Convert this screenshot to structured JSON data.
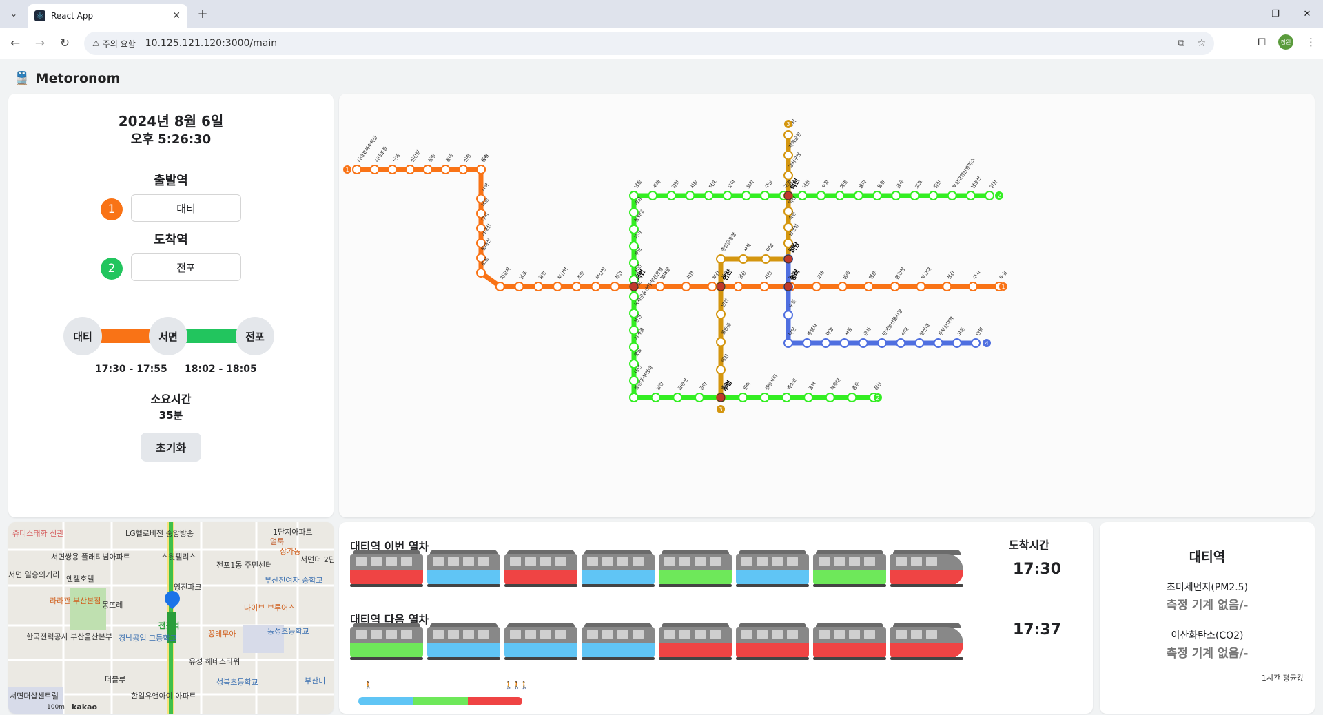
{
  "browser": {
    "tab_title": "React App",
    "security_label": "주의 요함",
    "url": "10.125.121.120:3000/main",
    "profile_initials": "정원"
  },
  "app": {
    "title": "Metoronom",
    "date": "2024년 8월 6일",
    "time": "오후 5:26:30",
    "departure_label": "출발역",
    "departure_line": "1",
    "departure_station": "대티",
    "arrival_label": "도착역",
    "arrival_line": "2",
    "arrival_station": "전포",
    "route": {
      "start": "대티",
      "transfer": "서면",
      "end": "전포",
      "segment1_time": "17:30 - 17:55",
      "segment2_time": "18:02 - 18:05",
      "segment1_color": "#f97316",
      "segment2_color": "#22c55e"
    },
    "duration_label": "소요시간",
    "duration": "35분",
    "reset_label": "초기화"
  },
  "colors": {
    "line1": "#f97316",
    "line2": "#33ee22",
    "line3": "#d4960f",
    "line4": "#4f6fe0"
  },
  "subway_map": {
    "line1_stations": [
      "다대포해수욕장",
      "다대포항",
      "낫개",
      "신장림",
      "장림",
      "동매",
      "신평",
      "하단",
      "당리",
      "사하",
      "괴정",
      "대티",
      "서대신",
      "동대신",
      "토성",
      "자갈치",
      "남포",
      "중앙",
      "부산역",
      "초량",
      "부산진",
      "좌천",
      "범일",
      "범내골",
      "서면",
      "부전",
      "양정",
      "시청",
      "연산",
      "교대",
      "동래",
      "명륜",
      "온천장",
      "부산대",
      "장전",
      "구서",
      "두실",
      "남산",
      "범어사",
      "노포"
    ],
    "line2_stations": [
      "양산",
      "남양산",
      "부산대양산캠퍼스",
      "증산",
      "호포",
      "금곡",
      "동원",
      "율리",
      "화명",
      "수정",
      "덕천",
      "구명",
      "구남",
      "모라",
      "모덕",
      "덕포",
      "사상",
      "감전",
      "주례",
      "냉정",
      "개금",
      "동의대",
      "가야",
      "부암",
      "서면",
      "전포",
      "국제금융센터·부산은행",
      "문현",
      "지게골",
      "못골",
      "대연",
      "경성대·부경대",
      "남천",
      "금련산",
      "광안",
      "수영",
      "민락",
      "센텀시티",
      "벡스코",
      "동백",
      "해운대",
      "중동",
      "장산"
    ],
    "line3_stations": [
      "대저",
      "체육공원",
      "강서구청",
      "구포",
      "덕천",
      "숙등",
      "남산정",
      "만덕",
      "미남",
      "사직",
      "종합운동장",
      "거제",
      "연산",
      "물만골",
      "배산",
      "망미",
      "수영"
    ],
    "line4_stations": [
      "미남",
      "동래",
      "수안",
      "낙민",
      "충렬사",
      "명장",
      "서동",
      "금사",
      "반여농산물시장",
      "석대",
      "영산대",
      "동부산대학",
      "고촌",
      "안평"
    ],
    "line_badges": [
      "1",
      "2",
      "3",
      "4"
    ],
    "transfer_labels": [
      "서면",
      "연산",
      "수영",
      "덕천",
      "미남",
      "동래"
    ]
  },
  "kakao_map": {
    "labels": [
      "쥬디스태화 신관",
      "LG헬로비전 중앙방송",
      "서면쌍용 플래티넘아파트",
      "스윗팰리스",
      "전포1동 주민센터",
      "얼룩",
      "서면더 2단지",
      "1단지아파트",
      "상가동",
      "서면 일승의거리",
      "엔젤호텔",
      "영진파크",
      "부산진여자 중학교",
      "라라관 부산본점",
      "몽뜨레",
      "나이브 브루어스",
      "동성초등학교",
      "한국전력공사 부산울산본부",
      "경남공업 고등학교",
      "전포역",
      "꽁테무아",
      "유성 해네스타워",
      "더블루",
      "성북초등학교",
      "부산미",
      "서면더샵센트럴",
      "한일유앤아이 아파트",
      "100m",
      "kakao"
    ],
    "station_name": "전포역",
    "scale": "100m",
    "brand": "kakao"
  },
  "trains": {
    "current_title": "대티역 이번 열차",
    "next_title": "대티역 다음 열차",
    "arrival_header": "도착시간",
    "current_arrival": "17:30",
    "next_arrival": "17:37",
    "current_cars": [
      "#ef4444",
      "#60c5f5",
      "#ef4444",
      "#60c5f5",
      "#6ee85a",
      "#60c5f5",
      "#6ee85a",
      "#ef4444"
    ],
    "next_cars": [
      "#6ee85a",
      "#60c5f5",
      "#60c5f5",
      "#60c5f5",
      "#ef4444",
      "#ef4444",
      "#ef4444",
      "#ef4444"
    ],
    "congestion_legend": [
      "#60c5f5",
      "#6ee85a",
      "#ef4444"
    ],
    "low_icon": "person-few-icon",
    "high_icon": "person-many-icon"
  },
  "air": {
    "station": "대티역",
    "pm_label": "초미세먼지(PM2.5)",
    "pm_value": "측정 기계 없음/-",
    "co2_label": "이산화탄소(CO2)",
    "co2_value": "측정 기계 없음/-",
    "footnote": "1시간 평균값"
  }
}
